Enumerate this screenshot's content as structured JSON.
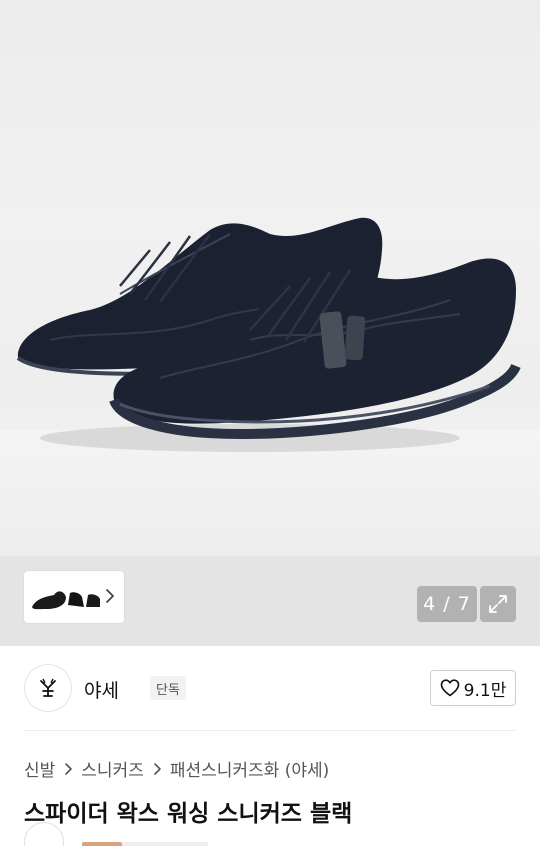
{
  "gallery": {
    "product_image": "black waxed washing sneakers pair",
    "thumbnail_image": "shoe thumbnails strip",
    "counter": {
      "current": "4",
      "total": "7",
      "text": "4 / 7"
    }
  },
  "icons": {
    "chevron": "chevron-right-icon",
    "expand": "expand-icon",
    "heart": "heart-outline-icon",
    "logo": "yase-logo"
  },
  "seller": {
    "name": "야세",
    "badge": "단독",
    "likes": "9.1만"
  },
  "breadcrumb": [
    "신발",
    "스니커즈",
    "패션스니커즈화 (야세)"
  ],
  "product": {
    "title": "스파이더 왁스 워싱 스니커즈 블랙"
  },
  "colors": {
    "accent": "#d9a27a",
    "text": "#111111",
    "muted": "#555555"
  }
}
